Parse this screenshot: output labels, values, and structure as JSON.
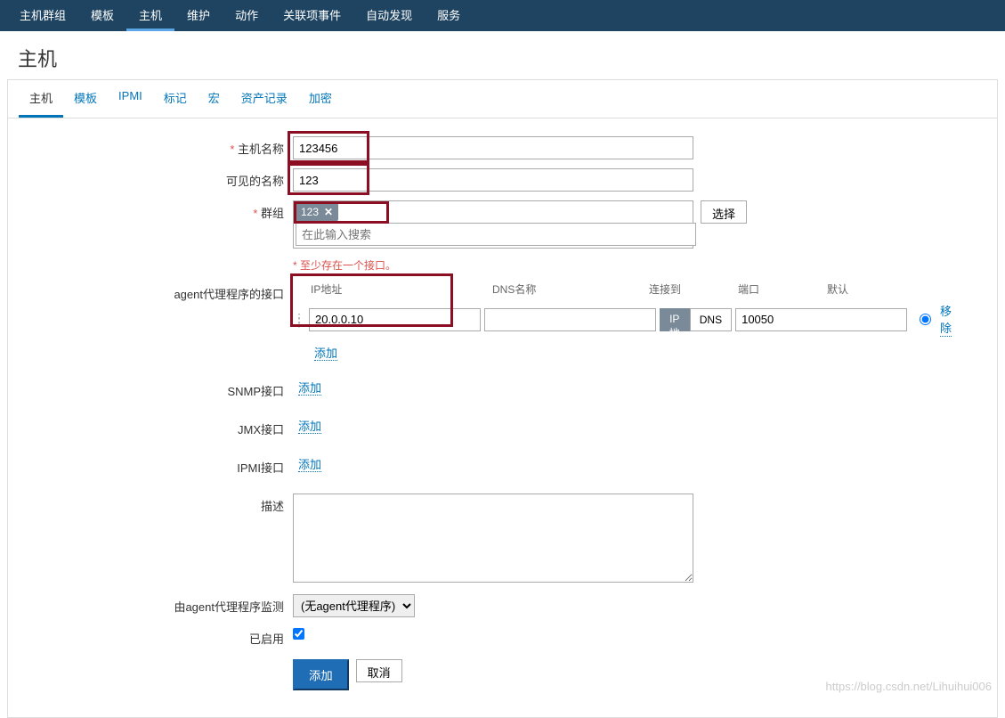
{
  "topnav": {
    "items": [
      "主机群组",
      "模板",
      "主机",
      "维护",
      "动作",
      "关联项事件",
      "自动发现",
      "服务"
    ],
    "active_index": 2
  },
  "page_title": "主机",
  "tabs": {
    "items": [
      "主机",
      "模板",
      "IPMI",
      "标记",
      "宏",
      "资产记录",
      "加密"
    ],
    "active_index": 0
  },
  "form": {
    "host_name_label": "主机名称",
    "host_name_value": "123456",
    "visible_name_label": "可见的名称",
    "visible_name_value": "123",
    "group_label": "群组",
    "group_tag": "123",
    "group_search_placeholder": "在此输入搜索",
    "select_button": "选择",
    "interface_warning": "至少存在一个接口。",
    "agent_interface_label": "agent代理程序的接口",
    "columns": {
      "ip": "IP地址",
      "dns": "DNS名称",
      "connect": "连接到",
      "port": "端口",
      "default": "默认"
    },
    "agent_row": {
      "ip": "20.0.0.10",
      "dns": "",
      "connect_ip": "IP地址",
      "connect_dns": "DNS",
      "port": "10050",
      "remove": "移除"
    },
    "add_link": "添加",
    "snmp_label": "SNMP接口",
    "jmx_label": "JMX接口",
    "ipmi_label": "IPMI接口",
    "description_label": "描述",
    "description_value": "",
    "monitored_by_label": "由agent代理程序监测",
    "monitored_by_value": "(无agent代理程序)",
    "enabled_label": "已启用",
    "add_button": "添加",
    "cancel_button": "取消"
  },
  "watermark": "https://blog.csdn.net/Lihuihui006"
}
